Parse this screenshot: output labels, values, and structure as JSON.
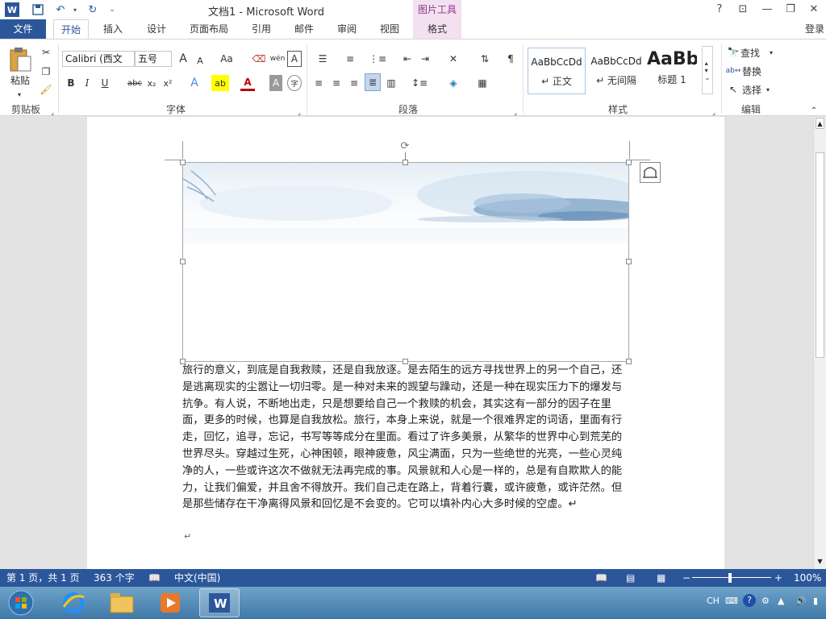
{
  "titlebar": {
    "app_logo": "W",
    "doc_title": "文档1 - Microsoft Word",
    "tools_label": "图片工具",
    "help": "?",
    "ribbon_opt": "⊡",
    "minimize": "—",
    "restore": "❐",
    "close": "✕"
  },
  "tabs": {
    "file": "文件",
    "home": "开始",
    "insert": "插入",
    "design": "设计",
    "layout": "页面布局",
    "references": "引用",
    "mailings": "邮件",
    "review": "审阅",
    "view": "视图",
    "format": "格式",
    "login": "登录"
  },
  "ribbon": {
    "clipboard": {
      "paste": "粘贴",
      "label": "剪贴板"
    },
    "font": {
      "font_name": "Calibri (西文",
      "font_size": "五号",
      "grow": "A",
      "shrink": "A",
      "change_case": "Aa",
      "phonetic": "wén",
      "border_char": "A",
      "bold": "B",
      "italic": "I",
      "underline": "U",
      "strike": "abc",
      "subscript": "x₂",
      "superscript": "x²",
      "text_effect": "A",
      "highlight": "ab",
      "font_color": "A",
      "char_shade": "A",
      "enclose": "字",
      "label": "字体"
    },
    "paragraph": {
      "label": "段落"
    },
    "styles": {
      "items": [
        {
          "sample": "AaBbCcDd",
          "name": "↵ 正文"
        },
        {
          "sample": "AaBbCcDd",
          "name": "↵ 无间隔"
        },
        {
          "sample": "AaBb",
          "name": "标题 1"
        }
      ],
      "label": "样式"
    },
    "editing": {
      "find": "查找",
      "replace": "替换",
      "select": "选择",
      "label": "编辑"
    }
  },
  "document": {
    "body": "旅行的意义，到底是自我救赎，还是自我放逐。是去陌生的远方寻找世界上的另一个自己，还是逃离现实的尘嚣让一切归零。是一种对未来的觊望与躁动，还是一种在现实压力下的爆发与抗争。有人说，不断地出走，只是想要给自己一个救赎的机会，其实这有一部分的因子在里面，更多的时候，也算是自我放松。旅行，本身上来说，就是一个很难界定的词语，里面有行走，回忆，追寻，忘记，书写等等成分在里面。看过了许多美景，从繁华的世界中心到荒芜的世界尽头。穿越过生死，心神困顿，眼神疲惫，风尘满面，只为一些绝世的光亮，一些心灵纯净的人，一些或许这次不做就无法再完成的事。风景就和人心是一样的，总是有自欺欺人的能力，让我们偏爱，并且舍不得放开。我们自己走在路上，背着行囊，或许疲惫，或许茫然。但是那些储存在干净离得风景和回忆是不会变的。它可以填补内心大多时候的空虚。↵",
    "empty_para": "↵"
  },
  "statusbar": {
    "page": "第 1 页，共 1 页",
    "words": "363 个字",
    "language": "中文(中国)",
    "zoom": "100%"
  },
  "taskbar": {
    "ime": "CH",
    "colors": {
      "accent": "#2b579a",
      "format_tab": "#f3e0f0"
    }
  }
}
